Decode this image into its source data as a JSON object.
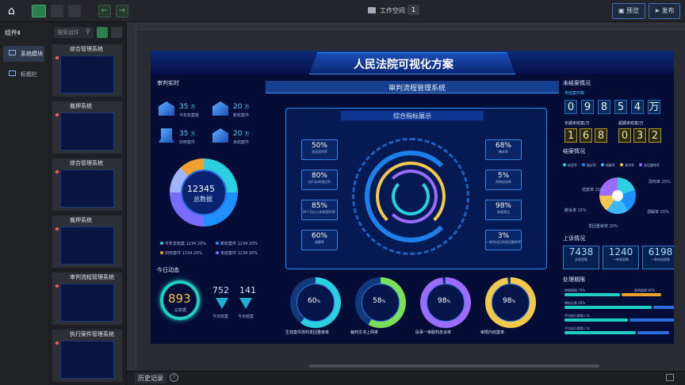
{
  "topbar": {
    "workspace": "工作空间 -",
    "ws_num": "1",
    "preview": "预览",
    "publish": "发布"
  },
  "sidebar": {
    "title": "组件",
    "search_ph": "搜索组件",
    "items": [
      {
        "label": "系统模块"
      },
      {
        "label": "标题栏"
      }
    ]
  },
  "components": [
    {
      "name": "综合管理系统"
    },
    {
      "name": "裁押系统"
    },
    {
      "name": "综合管理系统"
    },
    {
      "name": "裁押系统"
    },
    {
      "name": "审判流程管理系统"
    },
    {
      "name": "执行案件管理系统"
    }
  ],
  "bottom": {
    "history": "历史记录"
  },
  "dash": {
    "title": "人民法院可视化方案",
    "subtitle": "审判流程管理系统",
    "left_title": "审判实时",
    "stats": [
      {
        "v": "35",
        "u": "万",
        "l": "今年收案数"
      },
      {
        "v": "20",
        "u": "万",
        "l": "新收案件"
      },
      {
        "v": "35",
        "u": "万",
        "l": "旧存案件"
      },
      {
        "v": "20",
        "u": "万",
        "l": "未结案件"
      }
    ],
    "donut": {
      "value": "12345",
      "label": "总数据"
    },
    "legend": [
      {
        "l": "今年去结案 1234 20%",
        "c": "#2bd0e0"
      },
      {
        "l": "新收案件 1234 20%",
        "c": "#1e90ff"
      },
      {
        "l": "旧存案件 1234 20%",
        "c": "#f0a030"
      },
      {
        "l": "未结案件 1234 20%",
        "c": "#7a6cff"
      }
    ],
    "today_title": "今日动态",
    "today": {
      "total": "893",
      "total_l": "总数据",
      "a": "752",
      "a_l": "今日收案",
      "b": "141",
      "b_l": "今日结案"
    },
    "center_title": "综合指标展示",
    "left_kpis": [
      {
        "v": "50%",
        "l": "发回改判率"
      },
      {
        "v": "80%",
        "l": "执行标的到位率"
      },
      {
        "v": "85%",
        "l": "18个月以上未结案件率/\n长期未决案件"
      },
      {
        "v": "60%",
        "l": "调解率"
      }
    ],
    "right_kpis": [
      {
        "v": "68%",
        "l": "撤诉率"
      },
      {
        "v": "5%",
        "l": "再审启动率"
      },
      {
        "v": "98%",
        "l": "结收案比"
      },
      {
        "v": "3%",
        "l": "一审判决后的发回重审率"
      }
    ],
    "gauges": [
      {
        "v": "60",
        "u": "%",
        "l": "生效案件改判发回重审率"
      },
      {
        "v": "58",
        "u": "%",
        "l": "裁判文书上网率"
      },
      {
        "v": "98",
        "u": "%",
        "l": "民事一审服判息诉率"
      },
      {
        "v": "98",
        "u": "%",
        "l": "审限内结案率"
      }
    ],
    "right_title": "未结案情况",
    "unfinished_label": "未结案件数",
    "digits1": [
      "0",
      "9",
      "8",
      "5",
      "4",
      "万"
    ],
    "long_l": "长期未结案/万",
    "long_d": [
      "1",
      "6",
      "8"
    ],
    "over_l": "超期未结案/万",
    "over_d": [
      "0",
      "3",
      "2"
    ],
    "close_title": "结案情况",
    "close_legend": [
      "结案率",
      "撤诉率",
      "调解率",
      "改判率",
      "发回重审率"
    ],
    "pie_labels": [
      "结案率 15%",
      "撤诉率 15%",
      "发回重审率 20%",
      "调解率 20%",
      "改判率 20%"
    ],
    "appeal_title": "上诉情况",
    "appeal": [
      {
        "v": "7438",
        "l": "总收案数"
      },
      {
        "v": "1240",
        "l": "一审收案数"
      },
      {
        "v": "6198",
        "l": "一审未结案数"
      }
    ],
    "period_title": "处理期限",
    "bars": [
      {
        "a": "审理期限 75%",
        "b": "即将超期 80%"
      },
      {
        "a": "审结天数 60%",
        "b": ""
      },
      {
        "a": "平均执行期限 / 均",
        "b": ""
      },
      {
        "a": "平均执行期限 / 均",
        "b": ""
      }
    ]
  }
}
